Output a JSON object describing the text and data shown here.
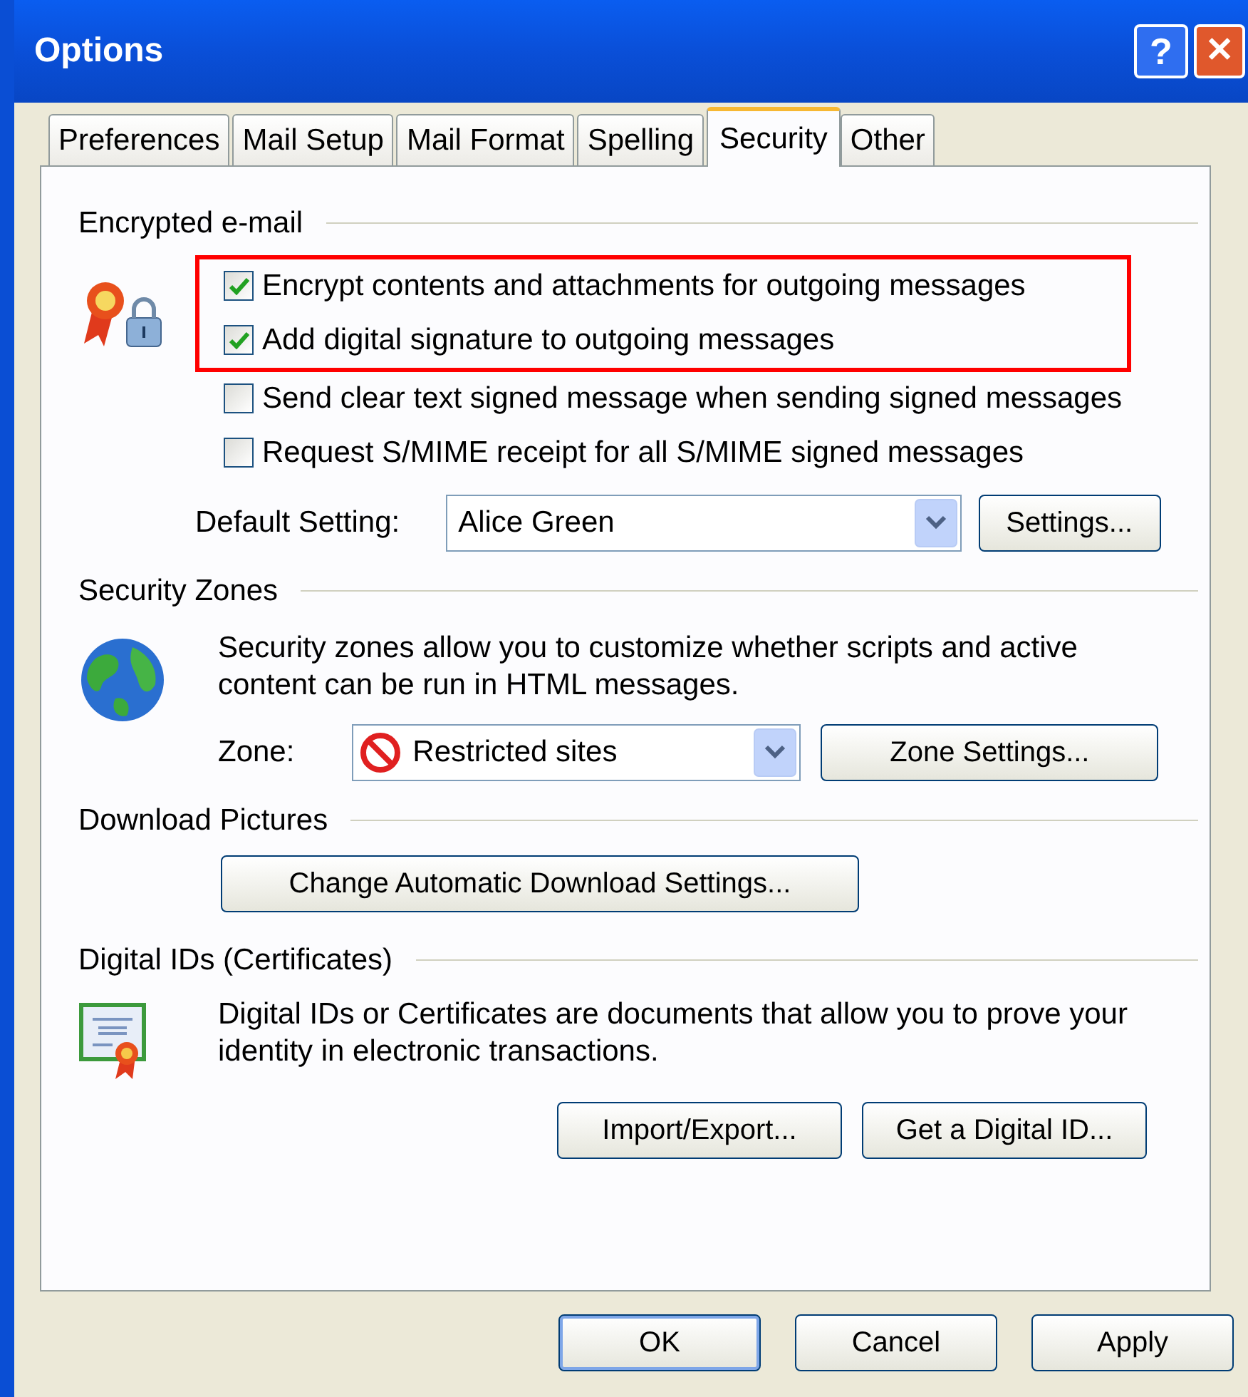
{
  "window": {
    "title": "Options",
    "help_button": "?",
    "close_button": "✕"
  },
  "tabs": [
    {
      "label": "Preferences",
      "selected": false
    },
    {
      "label": "Mail Setup",
      "selected": false
    },
    {
      "label": "Mail Format",
      "selected": false
    },
    {
      "label": "Spelling",
      "selected": false
    },
    {
      "label": "Security",
      "selected": true
    },
    {
      "label": "Other",
      "selected": false
    }
  ],
  "encrypted_email": {
    "heading": "Encrypted e-mail",
    "options": [
      {
        "label": "Encrypt contents and attachments for outgoing messages",
        "checked": true,
        "highlighted": true
      },
      {
        "label": "Add digital signature to outgoing messages",
        "checked": true,
        "highlighted": true
      },
      {
        "label": "Send clear text signed message when sending signed messages",
        "checked": false,
        "highlighted": false
      },
      {
        "label": "Request S/MIME receipt for all S/MIME signed messages",
        "checked": false,
        "highlighted": false
      }
    ],
    "default_setting_label": "Default Setting:",
    "default_setting_value": "Alice Green",
    "settings_button": "Settings..."
  },
  "security_zones": {
    "heading": "Security Zones",
    "description": "Security zones allow you to customize whether scripts and active content can be run in HTML messages.",
    "zone_label": "Zone:",
    "zone_value": "Restricted sites",
    "zone_settings_button": "Zone Settings..."
  },
  "download_pictures": {
    "heading": "Download Pictures",
    "button": "Change Automatic Download Settings..."
  },
  "digital_ids": {
    "heading": "Digital IDs (Certificates)",
    "description": "Digital IDs or Certificates are documents that allow you to prove your identity in electronic transactions.",
    "buttons": [
      "Import/Export...",
      "Get a Digital ID..."
    ]
  },
  "footer_buttons": [
    {
      "label": "OK",
      "default": true
    },
    {
      "label": "Cancel",
      "default": false
    },
    {
      "label": "Apply",
      "default": false
    }
  ]
}
